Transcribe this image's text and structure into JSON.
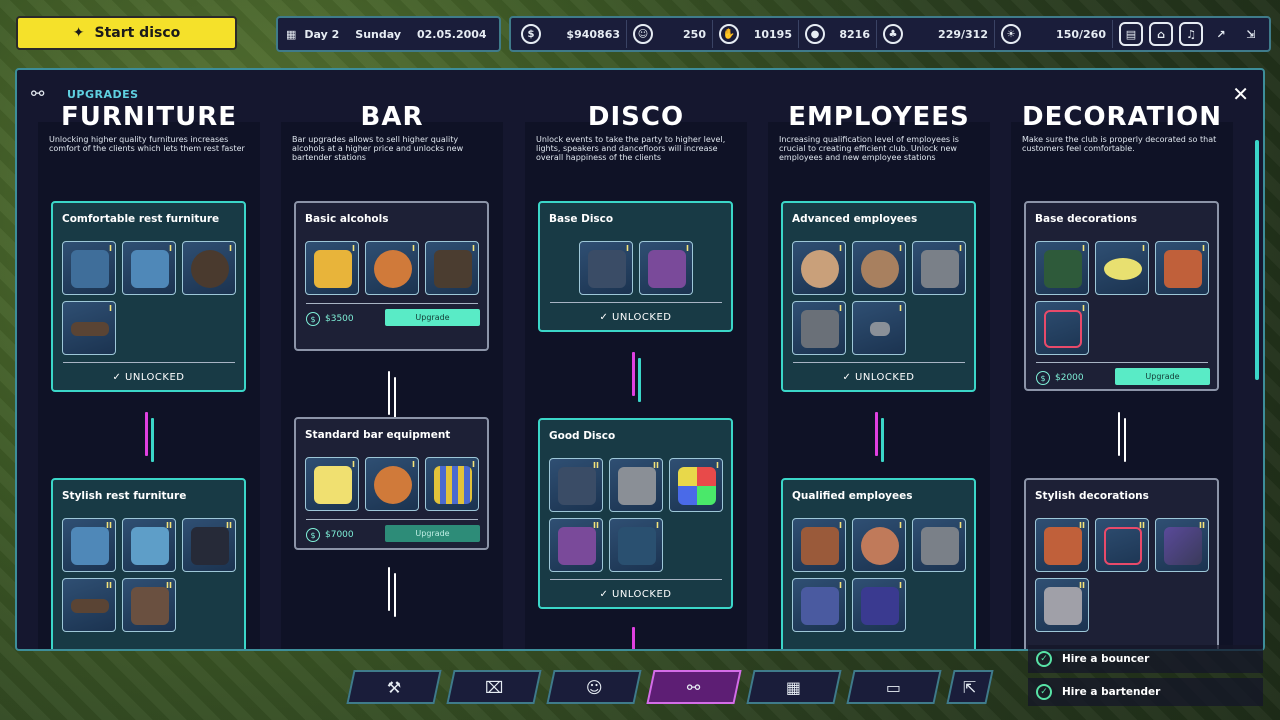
{
  "top": {
    "start_label": "Start disco",
    "day": "Day 2",
    "weekday": "Sunday",
    "date": "02.05.2004",
    "stats": [
      {
        "icon": "money-icon",
        "value": "$940863"
      },
      {
        "icon": "people-icon",
        "value": "250"
      },
      {
        "icon": "hand-icon",
        "value": "10195"
      },
      {
        "icon": "pin-icon",
        "value": "8216"
      },
      {
        "icon": "capacity-icon",
        "value": "229/312"
      },
      {
        "icon": "light-icon",
        "value": "150/260"
      }
    ]
  },
  "panel": {
    "title": "UPGRADES",
    "columns": [
      {
        "heading": "FURNITURE",
        "desc": "Unlocking higher quality furnitures increases comfort of the clients which lets them rest faster",
        "cards": [
          {
            "title": "Comfortable rest furniture",
            "status": "UNLOCKED",
            "items": [
              "I",
              "I",
              "I",
              "I"
            ]
          },
          {
            "title": "Stylish rest furniture",
            "items": [
              "II",
              "II",
              "II",
              "II",
              "II"
            ]
          }
        ]
      },
      {
        "heading": "BAR",
        "desc": "Bar upgrades allows to sell higher quality alcohols at a higher price and unlocks new bartender stations",
        "cards": [
          {
            "title": "Basic alcohols",
            "price": "$3500",
            "button": "Upgrade",
            "items": [
              "I",
              "I",
              "I"
            ]
          },
          {
            "title": "Standard bar equipment",
            "price": "$7000",
            "button": "Upgrade",
            "items": [
              "I",
              "I",
              "I"
            ]
          }
        ]
      },
      {
        "heading": "DISCO",
        "desc": "Unlock events to take the party to higher level, lights, speakers and dancefloors will increase overall happiness of the clients",
        "cards": [
          {
            "title": "Base Disco",
            "status": "UNLOCKED",
            "items": [
              "I",
              "I"
            ]
          },
          {
            "title": "Good Disco",
            "status": "UNLOCKED",
            "items": [
              "II",
              "II",
              "I",
              "II",
              "I"
            ]
          }
        ]
      },
      {
        "heading": "EMPLOYEES",
        "desc": "Increasing qualification level of employees is crucial to creating efficient club. Unlock new employees and new employee stations",
        "cards": [
          {
            "title": "Advanced employees",
            "status": "UNLOCKED",
            "items": [
              "I",
              "I",
              "I",
              "I",
              "I"
            ]
          },
          {
            "title": "Qualified employees",
            "items": [
              "I",
              "I",
              "I",
              "I",
              "I"
            ]
          }
        ]
      },
      {
        "heading": "DECORATION",
        "desc": "Make sure the club is properly decorated so that customers feel comfortable.",
        "cards": [
          {
            "title": "Base decorations",
            "price": "$2000",
            "button": "Upgrade",
            "items": [
              "I",
              "I",
              "I",
              "I"
            ]
          },
          {
            "title": "Stylish decorations",
            "items": [
              "II",
              "II",
              "II",
              "II"
            ]
          }
        ]
      }
    ]
  },
  "tasks": [
    "Hire a bouncer",
    "Hire a bartender"
  ],
  "colors": {
    "accent": "#3bd6c8",
    "upgrade": "#59ebc6",
    "start": "#f5e12a",
    "active_tab": "#5d1e74"
  }
}
